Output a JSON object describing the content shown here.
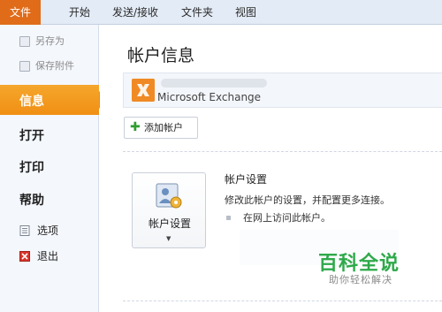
{
  "tabs": [
    "文件",
    "开始",
    "发送/接收",
    "文件夹",
    "视图"
  ],
  "sidebar": {
    "save_as": "另存为",
    "save_attachment": "保存附件",
    "info": "信息",
    "open": "打开",
    "print": "打印",
    "help": "帮助",
    "options": "选项",
    "exit": "退出"
  },
  "main": {
    "title": "帐户信息",
    "account_type": "Microsoft Exchange",
    "add_account": "添加帐户",
    "settings_button": "帐户设置",
    "settings_title": "帐户设置",
    "settings_desc": "修改此帐户的设置，并配置更多连接。",
    "settings_link": "在网上访问此帐户。"
  },
  "watermark": {
    "brand": "百科全说",
    "tagline": "助你轻松解决"
  },
  "colors": {
    "file_tab": "#e06c1a",
    "active_item": "#f08f14",
    "watermark": "#2ea94a"
  }
}
